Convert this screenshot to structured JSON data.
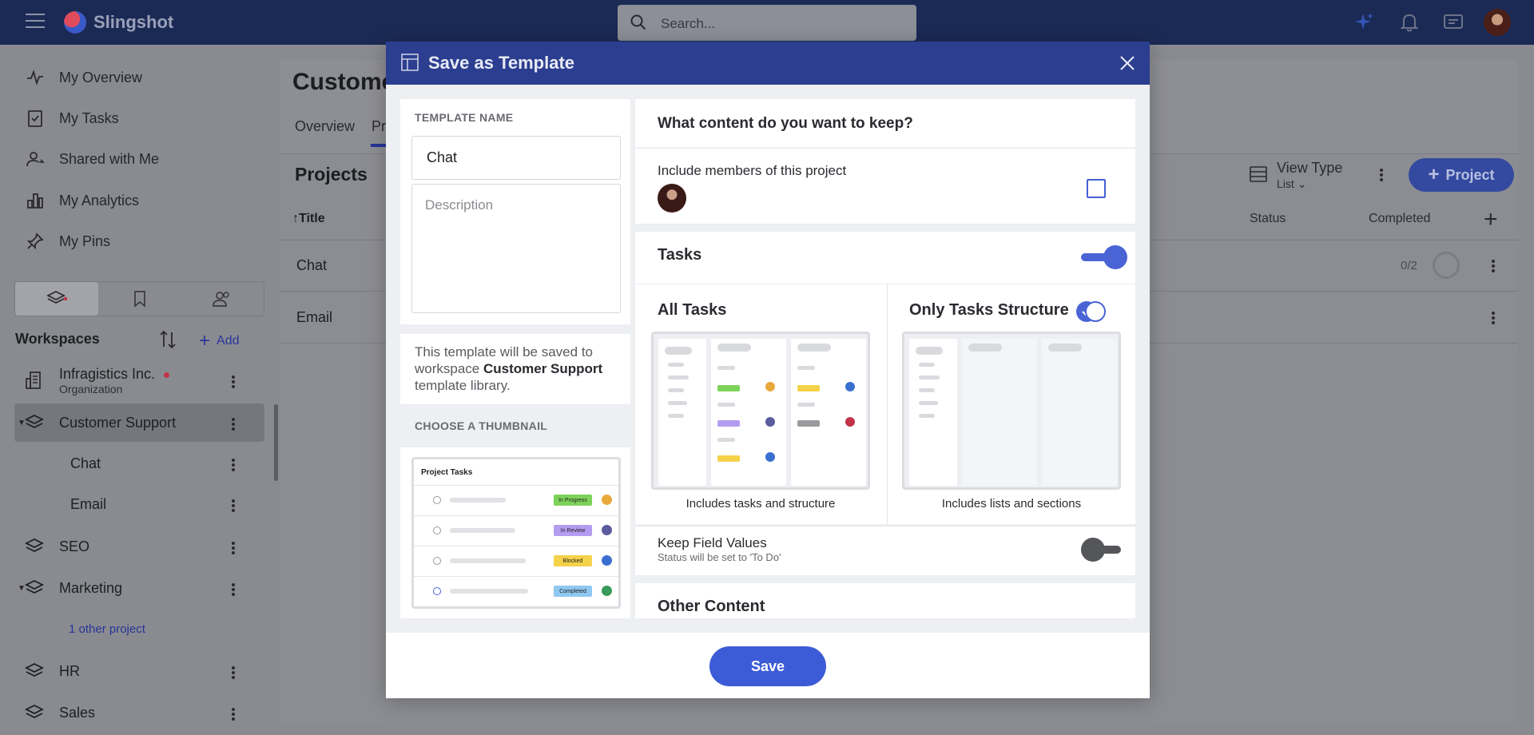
{
  "topbar": {
    "app_name": "Slingshot",
    "search_placeholder": "Search..."
  },
  "sidebar": {
    "nav": [
      {
        "label": "My Overview",
        "icon": "activity-icon"
      },
      {
        "label": "My Tasks",
        "icon": "task-checklist-icon"
      },
      {
        "label": "Shared with Me",
        "icon": "shared-user-icon"
      },
      {
        "label": "My Analytics",
        "icon": "bar-chart-icon"
      },
      {
        "label": "My Pins",
        "icon": "pin-icon"
      }
    ],
    "workspaces_title": "Workspaces",
    "add_label": "Add",
    "workspaces": [
      {
        "name": "Infragistics Inc.",
        "subtitle": "Organization"
      },
      {
        "name": "Customer Support"
      },
      {
        "name": "Chat"
      },
      {
        "name": "Email"
      },
      {
        "name": "SEO"
      },
      {
        "name": "Marketing"
      },
      {
        "name": "1 other project"
      },
      {
        "name": "HR"
      },
      {
        "name": "Sales"
      }
    ]
  },
  "main": {
    "title": "Custome",
    "tabs": [
      "Overview",
      "Pr"
    ],
    "projects_title": "Projects",
    "columns": {
      "title": "Title",
      "status": "Status",
      "completed": "Completed"
    },
    "rows": [
      {
        "title": "Chat",
        "completed": "0/2"
      },
      {
        "title": "Email",
        "completed": ""
      }
    ],
    "view_type_label": "View Type",
    "view_type_value": "List",
    "project_button": "Project"
  },
  "modal": {
    "title": "Save as Template",
    "template_name_label": "TEMPLATE NAME",
    "template_name_value": "Chat",
    "description_placeholder": "Description",
    "note_prefix": "This template will be saved to workspace ",
    "note_workspace": "Customer Support",
    "note_suffix": " template library.",
    "thumbnail_label": "CHOOSE A THUMBNAIL",
    "thumbnail": {
      "title": "Project Tasks",
      "tags": [
        {
          "label": "In Progress",
          "color": "#7dd35a"
        },
        {
          "label": "In Review",
          "color": "#b49cf0"
        },
        {
          "label": "Blocked",
          "color": "#f4d24a"
        },
        {
          "label": "Completed",
          "color": "#8fc8f0"
        }
      ]
    },
    "question": "What content do you want to keep?",
    "include_members_label": "Include members of this project",
    "include_members_checked": false,
    "tasks_label": "Tasks",
    "tasks_enabled": true,
    "options": [
      {
        "title": "All Tasks",
        "caption": "Includes tasks and structure",
        "selected": true
      },
      {
        "title": "Only Tasks Structure",
        "caption": "Includes lists and sections",
        "selected": false
      }
    ],
    "preview_tags": {
      "in_progress": "In Progress",
      "in_review": "In Review",
      "blocked": "Blocked",
      "to_do": "To Do"
    },
    "keep_field_values_label": "Keep Field Values",
    "keep_field_values_sub": "Status will be set to 'To Do'",
    "keep_field_values_enabled": false,
    "other_content_label": "Other Content",
    "save_button": "Save"
  },
  "colors": {
    "header": "#2c3e8f",
    "accent": "#4a64d6",
    "save_button": "#3c5bd6"
  }
}
